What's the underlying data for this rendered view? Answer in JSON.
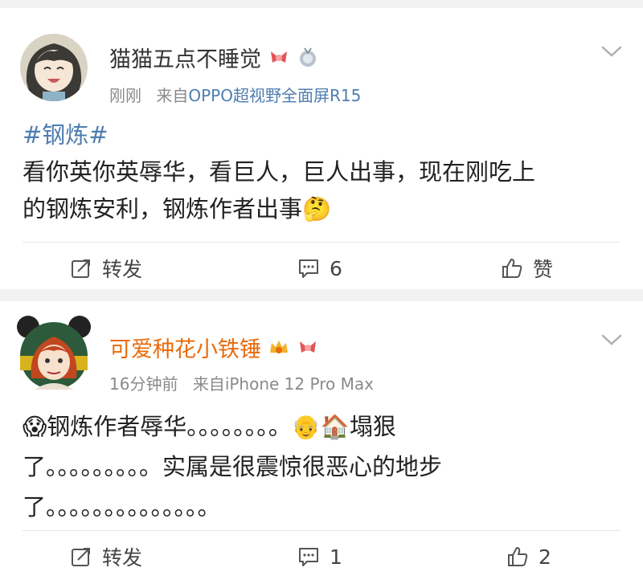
{
  "posts": [
    {
      "username": "猫猫五点不睡觉",
      "time": "刚刚",
      "source_prefix": "来自",
      "source": "OPPO超视野全面屏R15",
      "topic": "#钢炼#",
      "line1": "看你英你英辱华，看巨人，巨人出事，现在刚吃上",
      "line2": "的钢炼安利，钢炼作者出事",
      "emoji_end": "🤔",
      "repost_label": "转发",
      "comment_count": "6",
      "like_label": "赞",
      "name_color": "#333333"
    },
    {
      "username": "可爱种花小铁锤",
      "time": "16分钟前",
      "source_prefix": "来自",
      "source": "iPhone 12 Pro Max",
      "line1_text": "钢炼作者辱华。。。。。。。。",
      "line1_tail": "塌狠",
      "line2": "了。。。。。。。。。实属是很震惊很恶心的地步",
      "line3": "了。。。。。。。。。。。。。。",
      "repost_label": "转发",
      "comment_count": "1",
      "like_count": "2",
      "name_color": "#e86b0c"
    }
  ],
  "icons": {
    "emoji_start": "😱",
    "emoji_old_man": "👴",
    "emoji_house": "🏠"
  }
}
